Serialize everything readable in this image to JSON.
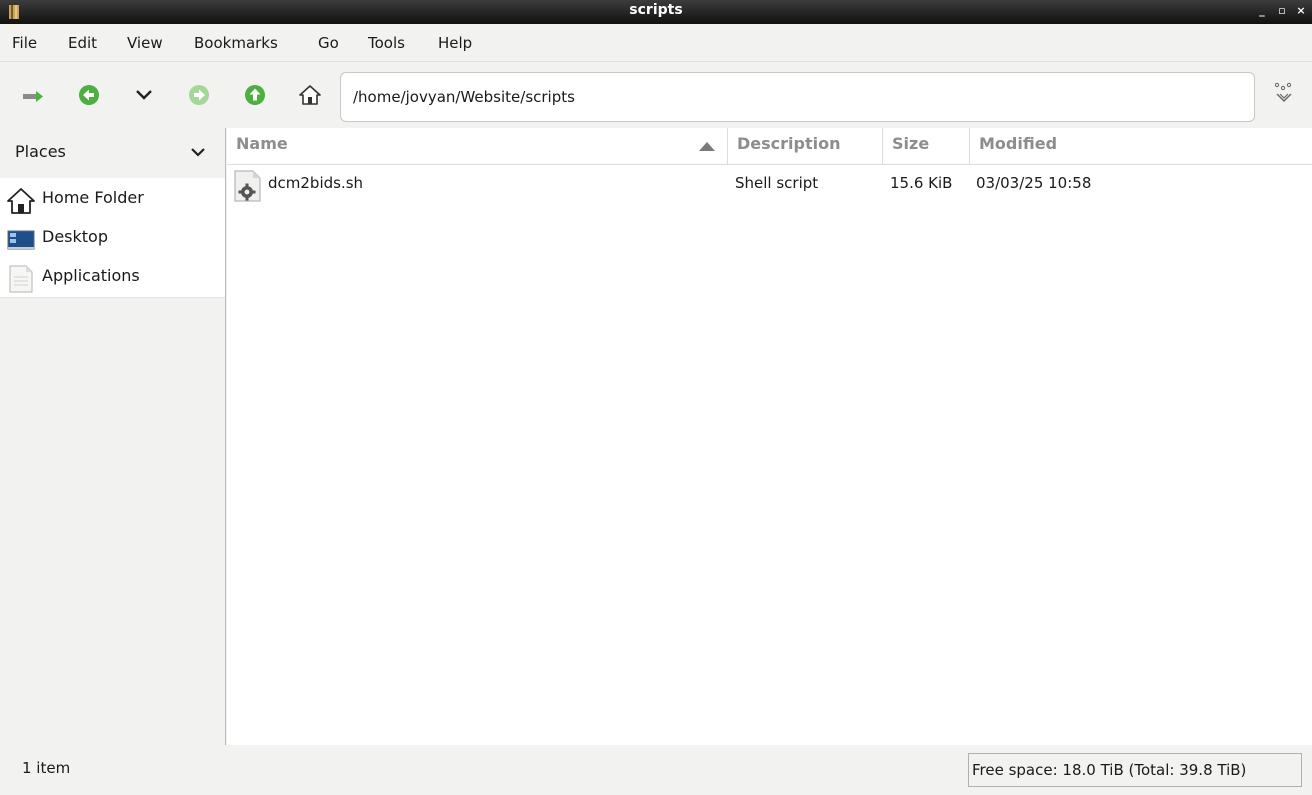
{
  "window": {
    "title": "scripts",
    "controls": {
      "minimize": "_",
      "maximize": "▫",
      "close": "×"
    }
  },
  "menubar": {
    "items": [
      {
        "label": "File"
      },
      {
        "label": "Edit"
      },
      {
        "label": "View"
      },
      {
        "label": "Bookmarks"
      },
      {
        "label": "Go"
      },
      {
        "label": "Tools"
      },
      {
        "label": "Help"
      }
    ]
  },
  "toolbar": {
    "location": "/home/jovyan/Website/scripts",
    "icons": [
      "new-tab-icon",
      "back-icon",
      "history-dropdown-icon",
      "forward-icon",
      "up-icon",
      "home-icon",
      "filter-icon"
    ],
    "colors": {
      "green": "#4caf3f",
      "green_disabled": "#a5d69a"
    }
  },
  "sidebar": {
    "header": "Places",
    "items": [
      {
        "label": "Home Folder",
        "icon": "home-folder-icon"
      },
      {
        "label": "Desktop",
        "icon": "desktop-icon"
      },
      {
        "label": "Applications",
        "icon": "applications-icon"
      }
    ]
  },
  "filelist": {
    "columns": [
      {
        "label": "Name"
      },
      {
        "label": "Description"
      },
      {
        "label": "Size"
      },
      {
        "label": "Modified"
      }
    ],
    "rows": [
      {
        "name": "dcm2bids.sh",
        "description": "Shell script",
        "size": "15.6 KiB",
        "modified": "03/03/25 10:58",
        "icon": "shell-script-icon"
      }
    ]
  },
  "statusbar": {
    "count": "1 item",
    "free_space": "Free space: 18.0 TiB (Total: 39.8 TiB)"
  }
}
